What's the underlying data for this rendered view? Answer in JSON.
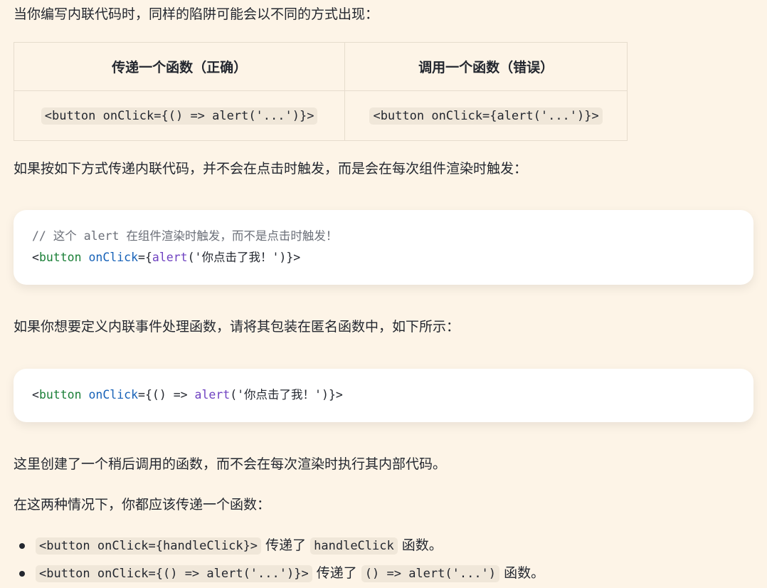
{
  "intro_text": "当你编写内联代码时，同样的陷阱可能会以不同的方式出现：",
  "comparison_table": {
    "headers": [
      "传递一个函数（正确）",
      "调用一个函数（错误）"
    ],
    "row": [
      "<button onClick={() => alert('...')}>",
      "<button onClick={alert('...')}>"
    ]
  },
  "text_render_trigger": "如果按如下方式传递内联代码，并不会在点击时触发，而是会在每次组件渲染时触发：",
  "code_block_1": {
    "comment": "// 这个 alert 在组件渲染时触发，而不是点击时触发！",
    "line2": {
      "lt": "<",
      "tag": "button",
      "sp": " ",
      "attr": "onClick",
      "eq": "={",
      "fn": "alert",
      "args": "('你点击了我！')",
      "close": "}>"
    }
  },
  "text_wrap_anon": "如果你想要定义内联事件处理函数，请将其包装在匿名函数中，如下所示：",
  "code_block_2": {
    "line1": {
      "lt": "<",
      "tag": "button",
      "sp": " ",
      "attr": "onClick",
      "eq": "={() => ",
      "fn": "alert",
      "args": "('你点击了我！')",
      "close": "}>"
    }
  },
  "text_later_call": "这里创建了一个稍后调用的函数，而不会在每次渲染时执行其内部代码。",
  "text_both_cases": "在这两种情况下，你都应该传递一个函数：",
  "bullets": [
    {
      "code1": "<button onClick={handleClick}>",
      "text1": " 传递了 ",
      "code2": "handleClick",
      "text2": " 函数。"
    },
    {
      "code1": "<button onClick={() => alert('...')}>",
      "text1": " 传递了 ",
      "code2": "() => alert('...')",
      "text2": " 函数。"
    }
  ],
  "colors": {
    "background": "#fdf4e7",
    "inline_code_bg": "#f0e7d9",
    "code_block_bg": "#ffffff",
    "tag": "#1a7f37",
    "attr": "#1762b8",
    "fn": "#6f42c1",
    "comment": "#6b6f78"
  }
}
